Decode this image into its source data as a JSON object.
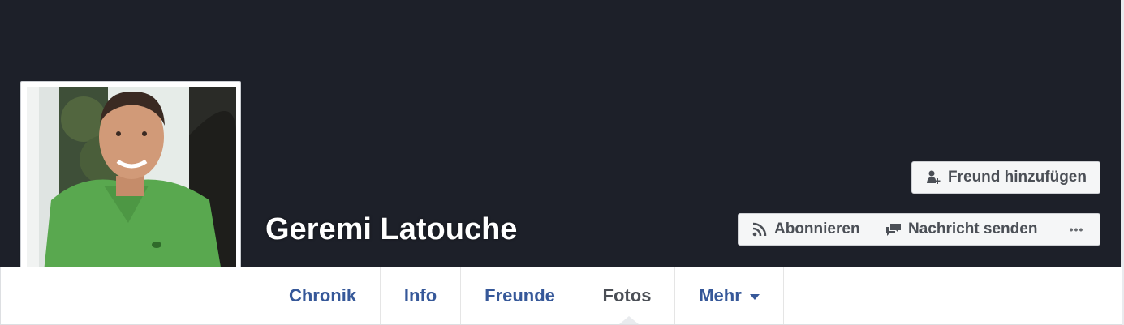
{
  "profile": {
    "name": "Geremi Latouche"
  },
  "actions": {
    "add_friend": "Freund hinzufügen",
    "subscribe": "Abonnieren",
    "send_message": "Nachricht senden",
    "more_label": "•••"
  },
  "tabs": [
    {
      "label": "Chronik",
      "active": false
    },
    {
      "label": "Info",
      "active": false
    },
    {
      "label": "Freunde",
      "active": false
    },
    {
      "label": "Fotos",
      "active": true
    },
    {
      "label": "Mehr",
      "active": false
    }
  ],
  "icons": {
    "add_friend": "add-friend-icon",
    "subscribe": "rss-icon",
    "send_message": "message-icon",
    "more": "ellipsis-icon",
    "dropdown": "caret-down-icon"
  },
  "colors": {
    "cover": "#1d2029",
    "link": "#365899",
    "active_tab": "#4b4f56",
    "button_bg": "#f5f6f7"
  }
}
